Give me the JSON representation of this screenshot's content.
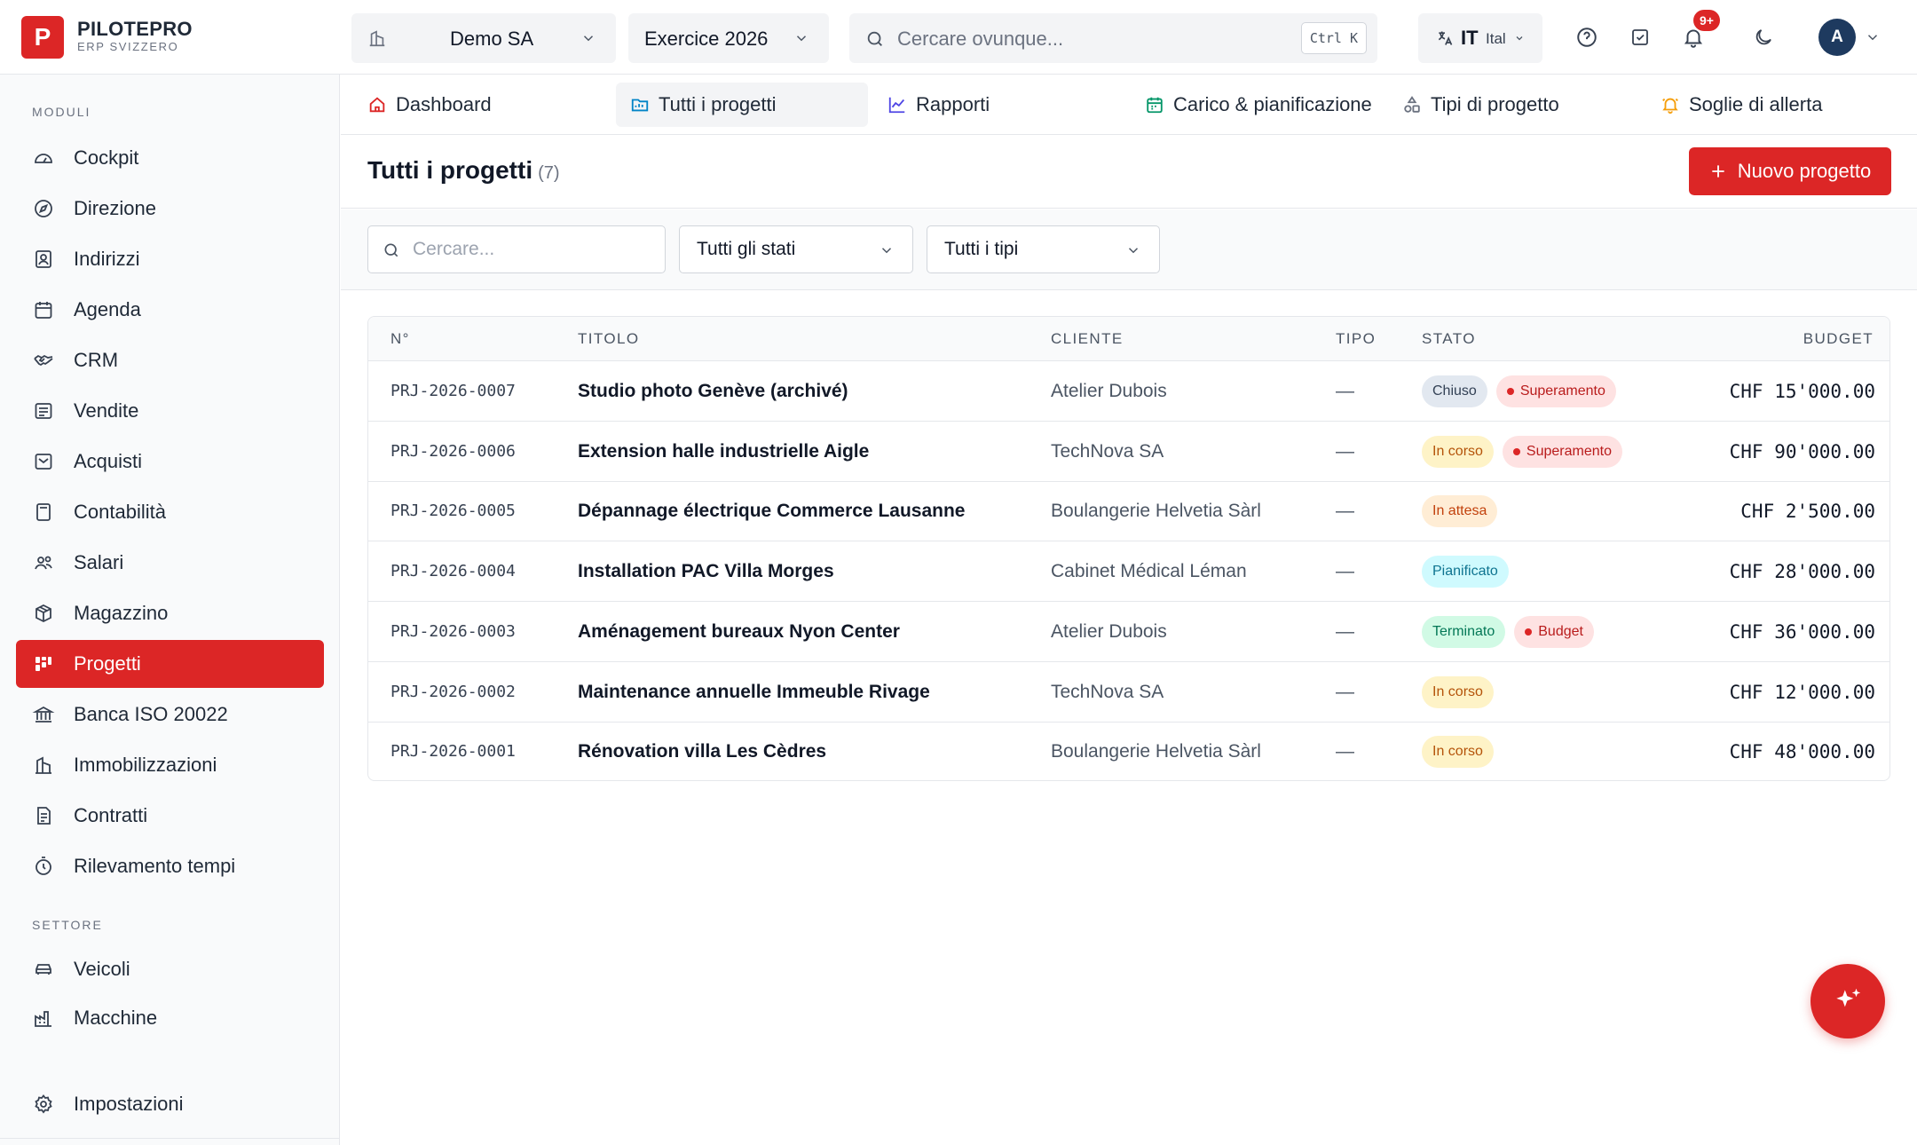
{
  "brand": {
    "logo_letter": "P",
    "name": "PILOTEPRO",
    "subtitle": "ERP SVIZZERO"
  },
  "topbar": {
    "company": "Demo SA",
    "fiscal_year": "Exercice 2026",
    "search_placeholder": "Cercare ovunque...",
    "search_shortcut": "Ctrl K",
    "lang_code": "IT",
    "lang_name": "Ital",
    "notifications_badge": "9+",
    "avatar_initial": "A"
  },
  "sidebar": {
    "section_modules": "MODULI",
    "modules": [
      {
        "label": "Cockpit",
        "icon": "gauge-icon"
      },
      {
        "label": "Direzione",
        "icon": "compass-icon"
      },
      {
        "label": "Indirizzi",
        "icon": "contact-icon"
      },
      {
        "label": "Agenda",
        "icon": "calendar-icon"
      },
      {
        "label": "CRM",
        "icon": "handshake-icon"
      },
      {
        "label": "Vendite",
        "icon": "receipt-icon"
      },
      {
        "label": "Acquisti",
        "icon": "inbox-icon"
      },
      {
        "label": "Contabilità",
        "icon": "calculator-icon"
      },
      {
        "label": "Salari",
        "icon": "users-icon"
      },
      {
        "label": "Magazzino",
        "icon": "package-icon"
      },
      {
        "label": "Progetti",
        "icon": "kanban-icon",
        "active": true
      },
      {
        "label": "Banca ISO 20022",
        "icon": "bank-icon"
      },
      {
        "label": "Immobilizzazioni",
        "icon": "building-icon"
      },
      {
        "label": "Contratti",
        "icon": "contract-icon"
      },
      {
        "label": "Rilevamento tempi",
        "icon": "timer-icon"
      }
    ],
    "section_sector": "SETTORE",
    "sector": [
      {
        "label": "Veicoli",
        "icon": "car-icon"
      },
      {
        "label": "Macchine",
        "icon": "factory-icon"
      }
    ],
    "settings": "Impostazioni"
  },
  "tabs": [
    {
      "label": "Dashboard",
      "icon": "home-icon"
    },
    {
      "label": "Tutti i progetti",
      "icon": "folder-icon",
      "active": true
    },
    {
      "label": "Rapporti",
      "icon": "line-chart-icon"
    },
    {
      "label": "Carico & pianificazione",
      "icon": "calendar-icon"
    },
    {
      "label": "Tipi di progetto",
      "icon": "shapes-icon"
    },
    {
      "label": "Soglie di allerta",
      "icon": "bell-icon"
    }
  ],
  "page": {
    "title": "Tutti i progetti",
    "count": "(7)",
    "new_button": "Nuovo progetto"
  },
  "filters": {
    "search_placeholder": "Cercare...",
    "status_select": "Tutti gli stati",
    "type_select": "Tutti i tipi"
  },
  "table": {
    "headers": {
      "num": "N°",
      "title": "TITOLO",
      "client": "CLIENTE",
      "type": "TIPO",
      "status": "STATO",
      "budget": "BUDGET"
    },
    "rows": [
      {
        "num": "PRJ-2026-0007",
        "title": "Studio photo Genève (archivé)",
        "client": "Atelier Dubois",
        "type": "—",
        "status": "Chiuso",
        "status_kind": "closed",
        "alert": "Superamento",
        "budget": "CHF 15'000.00"
      },
      {
        "num": "PRJ-2026-0006",
        "title": "Extension halle industrielle Aigle",
        "client": "TechNova SA",
        "type": "—",
        "status": "In corso",
        "status_kind": "progress",
        "alert": "Superamento",
        "budget": "CHF 90'000.00"
      },
      {
        "num": "PRJ-2026-0005",
        "title": "Dépannage électrique Commerce Lausanne",
        "client": "Boulangerie Helvetia Sàrl",
        "type": "—",
        "status": "In attesa",
        "status_kind": "waiting",
        "alert": "",
        "budget": "CHF 2'500.00"
      },
      {
        "num": "PRJ-2026-0004",
        "title": "Installation PAC Villa Morges",
        "client": "Cabinet Médical Léman",
        "type": "—",
        "status": "Pianificato",
        "status_kind": "planned",
        "alert": "",
        "budget": "CHF 28'000.00"
      },
      {
        "num": "PRJ-2026-0003",
        "title": "Aménagement bureaux Nyon Center",
        "client": "Atelier Dubois",
        "type": "—",
        "status": "Terminato",
        "status_kind": "done",
        "alert": "Budget",
        "budget": "CHF 36'000.00"
      },
      {
        "num": "PRJ-2026-0002",
        "title": "Maintenance annuelle Immeuble Rivage",
        "client": "TechNova SA",
        "type": "—",
        "status": "In corso",
        "status_kind": "progress",
        "alert": "",
        "budget": "CHF 12'000.00"
      },
      {
        "num": "PRJ-2026-0001",
        "title": "Rénovation villa Les Cèdres",
        "client": "Boulangerie Helvetia Sàrl",
        "type": "—",
        "status": "In corso",
        "status_kind": "progress",
        "alert": "",
        "budget": "CHF 48'000.00"
      }
    ]
  },
  "colors": {
    "accent": "#dc2626",
    "status_closed_bg": "#e2e8f0",
    "status_closed_fg": "#334155",
    "status_progress_bg": "#fef3c7",
    "status_progress_fg": "#b45309",
    "status_waiting_bg": "#ffedd5",
    "status_waiting_fg": "#c2410c",
    "status_planned_bg": "#cffafe",
    "status_planned_fg": "#0e7490",
    "status_done_bg": "#d1fae5",
    "status_done_fg": "#047857",
    "alert_bg": "#fee2e2",
    "alert_fg": "#b91c1c"
  }
}
